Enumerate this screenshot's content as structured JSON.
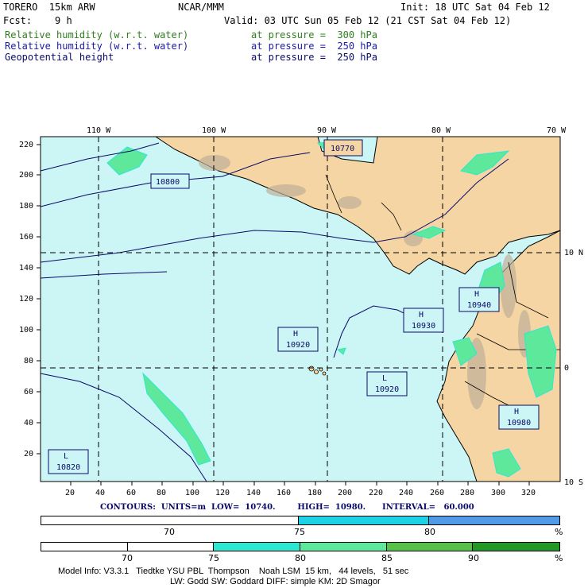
{
  "header": {
    "model": "TORERO  15km ARW",
    "org": "NCAR/MMM",
    "init": "Init: 18 UTC Sat 04 Feb 12",
    "fcst": "Fcst:    9 h",
    "valid": "Valid: 03 UTC Sun 05 Feb 12 (21 CST Sat 04 Feb 12)",
    "fields": [
      {
        "name": "Relative humidity (w.r.t. water)",
        "level": "at pressure =  300 hPa",
        "color": "#2e7d1e"
      },
      {
        "name": "Relative humidity (w.r.t. water)",
        "level": "at pressure =  250 hPa",
        "color": "#1a1aa8"
      },
      {
        "name": "Geopotential height",
        "level": "at pressure =  250 hPa",
        "color": "#0a0a6a"
      }
    ]
  },
  "map": {
    "lon_labels": [
      "110 W",
      "100 W",
      "90 W",
      "80 W",
      "70 W"
    ],
    "lat_labels": [
      "10 N",
      "0",
      "10 S"
    ],
    "y_ticks": [
      "220",
      "200",
      "180",
      "160",
      "140",
      "120",
      "100",
      "80",
      "60",
      "40",
      "20"
    ],
    "x_ticks": [
      "20",
      "40",
      "60",
      "80",
      "100",
      "120",
      "140",
      "160",
      "180",
      "200",
      "220",
      "240",
      "260",
      "280",
      "300",
      "320"
    ],
    "height_labels": [
      {
        "letter": "",
        "value": "10770"
      },
      {
        "letter": "",
        "value": "10800"
      },
      {
        "letter": "H",
        "value": "10940"
      },
      {
        "letter": "H",
        "value": "10930"
      },
      {
        "letter": "H",
        "value": "10920"
      },
      {
        "letter": "L",
        "value": "10920"
      },
      {
        "letter": "H",
        "value": "10980"
      },
      {
        "letter": "L",
        "value": "10820"
      }
    ],
    "colors": {
      "ocean": "#ccf5f5",
      "land": "#f5d5a3",
      "contour": "#0a0a6a"
    }
  },
  "contours_line": "CONTOURS:  UNITS=m  LOW=  10740.        HIGH=  10980.      INTERVAL=   60.000",
  "colorbar1": {
    "colors": [
      "#ffffff",
      "#1ed2e6",
      "#4f9be8"
    ],
    "labels": [
      "70",
      "75",
      "80"
    ],
    "unit": "%"
  },
  "colorbar2": {
    "colors": [
      "#ffffff",
      "#ffffff",
      "#2be8d2",
      "#5ee89c",
      "#55c147",
      "#229922"
    ],
    "labels": [
      "70",
      "75",
      "80",
      "85",
      "90"
    ],
    "unit": "%"
  },
  "footer": {
    "line1": "Model Info: V3.3.1   Tiedtke YSU PBL  Thompson    Noah LSM  15 km,   44 levels,   51 sec",
    "line2": "LW: Godd SW: Goddard DIFF: simple KM: 2D Smagor"
  }
}
